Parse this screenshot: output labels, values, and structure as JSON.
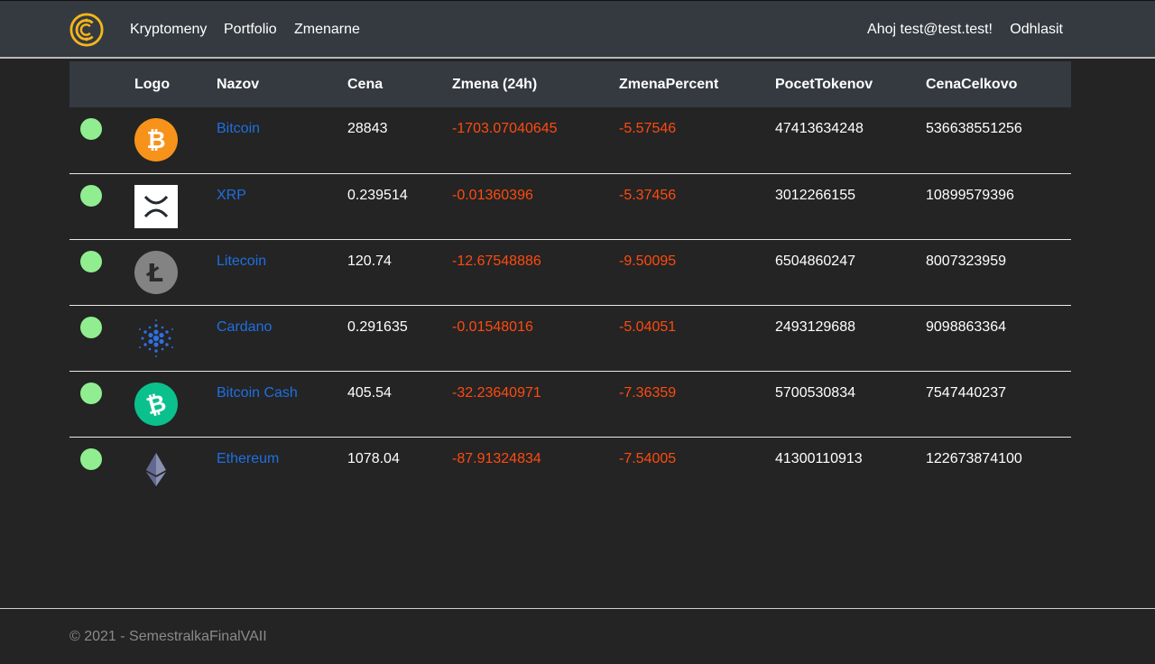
{
  "nav": {
    "links": [
      "Kryptomeny",
      "Portfolio",
      "Zmenarne"
    ],
    "greeting": "Ahoj test@test.test!",
    "logout": "Odhlasit",
    "brand_icon": "crypto-c-logo",
    "brand_color": "#f5b51c"
  },
  "table": {
    "headers": [
      "",
      "Logo",
      "Nazov",
      "Cena",
      "Zmena (24h)",
      "ZmenaPercent",
      "PocetTokenov",
      "CenaCelkovo"
    ],
    "rows": [
      {
        "icon": "bitcoin-logo",
        "name": "Bitcoin",
        "price": "28843",
        "change": "-1703.07040645",
        "percent": "-5.57546",
        "tokens": "47413634248",
        "total": "536638551256"
      },
      {
        "icon": "xrp-logo",
        "name": "XRP",
        "price": "0.239514",
        "change": "-0.01360396",
        "percent": "-5.37456",
        "tokens": "3012266155",
        "total": "10899579396"
      },
      {
        "icon": "litecoin-logo",
        "name": "Litecoin",
        "price": "120.74",
        "change": "-12.67548886",
        "percent": "-9.50095",
        "tokens": "6504860247",
        "total": "8007323959"
      },
      {
        "icon": "cardano-logo",
        "name": "Cardano",
        "price": "0.291635",
        "change": "-0.01548016",
        "percent": "-5.04051",
        "tokens": "2493129688",
        "total": "9098863364"
      },
      {
        "icon": "bitcoin-cash-logo",
        "name": "Bitcoin Cash",
        "price": "405.54",
        "change": "-32.23640971",
        "percent": "-7.36359",
        "tokens": "5700530834",
        "total": "7547440237"
      },
      {
        "icon": "ethereum-logo",
        "name": "Ethereum",
        "price": "1078.04",
        "change": "-87.91324834",
        "percent": "-7.54005",
        "tokens": "41300110913",
        "total": "122673874100"
      }
    ],
    "status_color": "#90ee90",
    "negative_color": "#ff4a0f",
    "link_color": "#1f6fe0"
  },
  "footer": {
    "text": "© 2021 - SemestralkaFinalVAII"
  }
}
